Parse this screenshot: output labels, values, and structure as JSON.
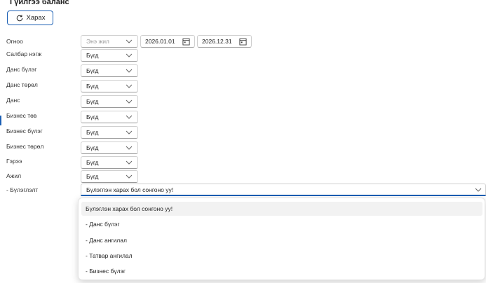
{
  "page": {
    "title": "Гүйлгээ баланс"
  },
  "toolbar": {
    "refresh_label": "Харах"
  },
  "filters": {
    "date": {
      "label": "Огноо",
      "period": "Энэ жил",
      "from": "2026.01.01",
      "to": "2026.12.31"
    },
    "rows": [
      {
        "label": "Салбар нэгж",
        "value": "Бүгд"
      },
      {
        "label": "Данс бүлэг",
        "value": "Бүгд"
      },
      {
        "label": "Данс төрөл",
        "value": "Бүгд"
      },
      {
        "label": "Данс",
        "value": "Бүгд"
      },
      {
        "label": "Бизнес төв",
        "value": "Бүгд"
      },
      {
        "label": "Бизнес бүлэг",
        "value": "Бүгд"
      },
      {
        "label": "Бизнес төрөл",
        "value": "Бүгд"
      },
      {
        "label": "Гэрээ",
        "value": "Бүгд"
      },
      {
        "label": "Ажил",
        "value": "Бүгд"
      }
    ],
    "grouping": {
      "label": "- Бүлэглэлт",
      "value": "Бүлэглэн харах бол сонгоно уу!"
    }
  },
  "dropdown": {
    "options": [
      "Бүлэглэн харах бол сонгоно уу!",
      "- Данс бүлэг",
      "- Данс ангилал",
      "- Татвар ангилал",
      "- Бизнес бүлэг"
    ],
    "selected_index": 0
  },
  "colors": {
    "accent": "#1a5fb4"
  }
}
